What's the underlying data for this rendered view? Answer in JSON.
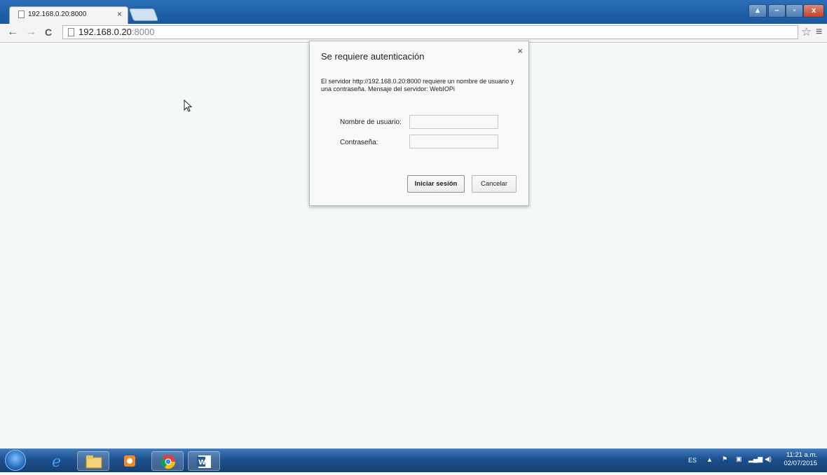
{
  "browser": {
    "tab_title": "192.168.0.20:8000",
    "tab_close": "×",
    "url_host": "192.168.0.20",
    "url_port": ":8000",
    "back_icon": "←",
    "forward_icon": "→",
    "reload_icon": "C",
    "star_icon": "☆",
    "menu_icon": "≡",
    "win_minimize": "–",
    "win_restore": "▫",
    "win_close": "x"
  },
  "dialog": {
    "title": "Se requiere autenticación",
    "close": "×",
    "message": "El servidor http://192.168.0.20:8000 requiere un nombre de usuario y una contraseña. Mensaje del servidor: WebIOPi",
    "username_label": "Nombre de usuario:",
    "password_label": "Contraseña:",
    "username_value": "",
    "password_value": "",
    "login_button": "Iniciar sesión",
    "cancel_button": "Cancelar"
  },
  "taskbar": {
    "items": [
      "start-orb",
      "internet-explorer-icon",
      "file-explorer-icon",
      "media-player-icon",
      "chrome-icon",
      "word-icon"
    ],
    "language": "ES",
    "time": "11:21 a.m.",
    "date": "02/07/2015"
  }
}
